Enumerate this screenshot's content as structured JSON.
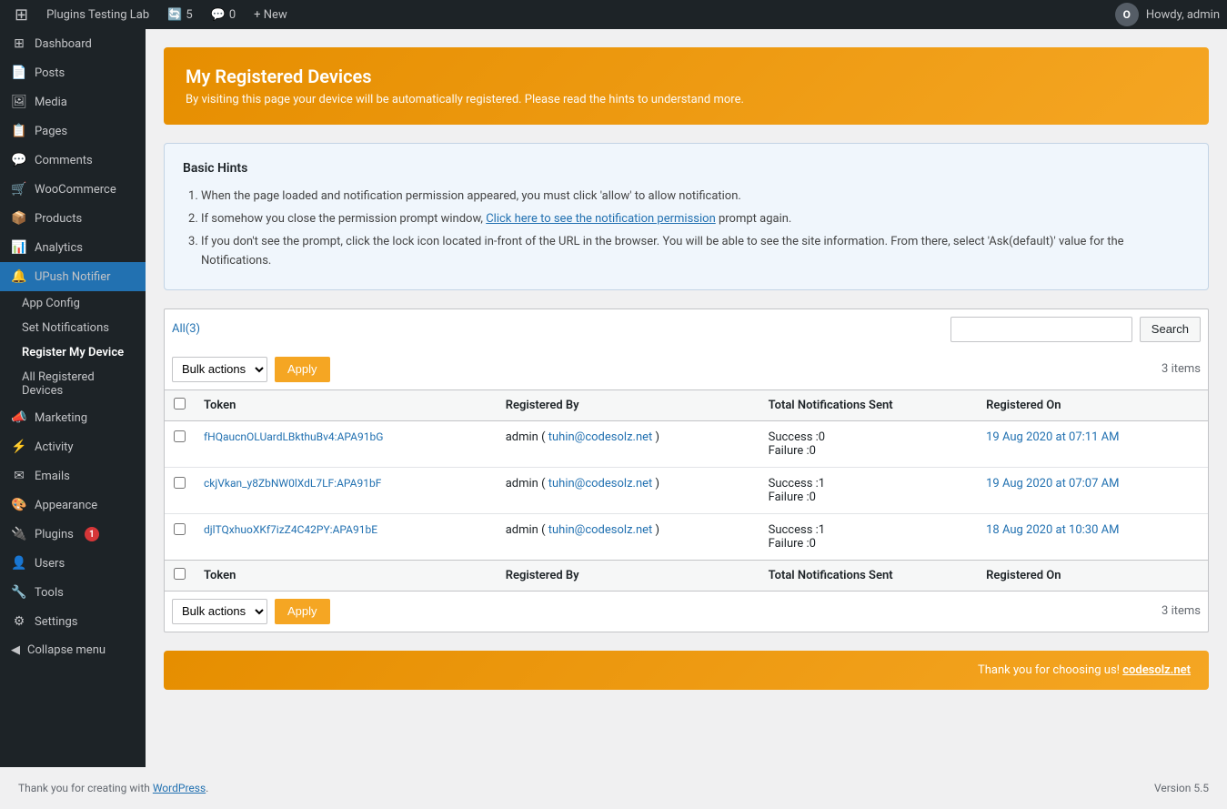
{
  "adminbar": {
    "site_name": "Plugins Testing Lab",
    "updates_count": "5",
    "comments_count": "0",
    "new_label": "+ New",
    "howdy": "Howdy, admin",
    "avatar_letter": "O"
  },
  "sidebar": {
    "items": [
      {
        "label": "Dashboard",
        "icon": "⊞"
      },
      {
        "label": "Posts",
        "icon": "📄"
      },
      {
        "label": "Media",
        "icon": "🖼"
      },
      {
        "label": "Pages",
        "icon": "📋"
      },
      {
        "label": "Comments",
        "icon": "💬"
      },
      {
        "label": "WooCommerce",
        "icon": "🛒"
      },
      {
        "label": "Products",
        "icon": "📦"
      },
      {
        "label": "Analytics",
        "icon": "📊"
      },
      {
        "label": "UPush Notifier",
        "icon": "🔔"
      },
      {
        "label": "Marketing",
        "icon": "📣"
      },
      {
        "label": "Activity",
        "icon": "⚡"
      },
      {
        "label": "Emails",
        "icon": "✉"
      },
      {
        "label": "Appearance",
        "icon": "🎨"
      },
      {
        "label": "Plugins",
        "icon": "🔌",
        "badge": "1"
      },
      {
        "label": "Users",
        "icon": "👤"
      },
      {
        "label": "Tools",
        "icon": "🔧"
      },
      {
        "label": "Settings",
        "icon": "⚙"
      }
    ],
    "upush_sub": [
      {
        "label": "App Config",
        "active": false
      },
      {
        "label": "Set Notifications",
        "active": false
      },
      {
        "label": "Register My Device",
        "active": true
      },
      {
        "label": "All Registered Devices",
        "active": false
      }
    ],
    "collapse_label": "Collapse menu"
  },
  "page": {
    "header_title": "My Registered Devices",
    "header_subtitle": "By visiting this page your device will be automatically registered. Please read the hints to understand more.",
    "hints": {
      "title": "Basic Hints",
      "items": [
        "When the page loaded and notification permission appeared, you must click 'allow' to allow notification.",
        "If somehow you close the permission prompt window, Click here to see the notification permission prompt again.",
        "If you don't see the prompt, click the lock icon located in-front of the URL in the browser. You will be able to see the site information. From there, select 'Ask(default)' value for the Notifications."
      ],
      "link_text": "Click here to see the notification permission",
      "link_after": " prompt again."
    },
    "filter_tabs": [
      {
        "label": "All(3)",
        "active": true
      }
    ],
    "search_placeholder": "",
    "search_label": "Search",
    "bulk_actions_label": "Bulk actions",
    "apply_label": "Apply",
    "items_count_top": "3 items",
    "items_count_bottom": "3 items",
    "table": {
      "columns": [
        "",
        "Token",
        "Registered By",
        "Total Notifications Sent",
        "Registered On"
      ],
      "rows": [
        {
          "token": "fHQaucnOLUardLBkthuBv4:APA91bG",
          "registered_by_name": "admin",
          "registered_by_email": "tuhin@codesolz.net",
          "notif_success": "Success :0",
          "notif_failure": "Failure :0",
          "registered_on": "19 Aug 2020 at 07:11 AM"
        },
        {
          "token": "ckjVkan_y8ZbNW0lXdL7LF:APA91bF",
          "registered_by_name": "admin",
          "registered_by_email": "tuhin@codesolz.net",
          "notif_success": "Success :1",
          "notif_failure": "Failure :0",
          "registered_on": "19 Aug 2020 at 07:07 AM"
        },
        {
          "token": "djlTQxhuoXKf7izZ4C42PY:APA91bE",
          "registered_by_name": "admin",
          "registered_by_email": "tuhin@codesolz.net",
          "notif_success": "Success :1",
          "notif_failure": "Failure :0",
          "registered_on": "18 Aug 2020 at 10:30 AM"
        }
      ]
    },
    "footer_banner_text": "Thank you for choosing us!",
    "footer_banner_link": "codesolz.net"
  },
  "footer": {
    "thank_you_text": "Thank you for creating with",
    "wp_link": "WordPress",
    "version": "Version 5.5"
  }
}
